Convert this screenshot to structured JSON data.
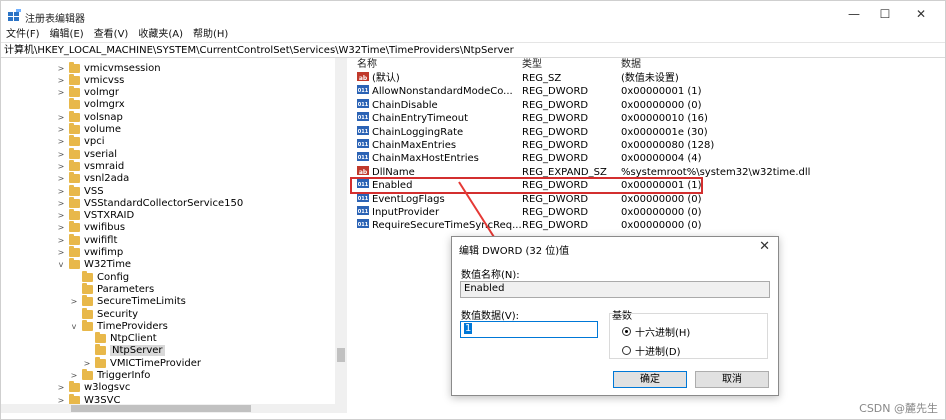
{
  "window": {
    "title": "注册表编辑器",
    "minimize": "—",
    "maximize": "☐",
    "close": "✕"
  },
  "menu": [
    "文件(F)",
    "编辑(E)",
    "查看(V)",
    "收藏夹(A)",
    "帮助(H)"
  ],
  "address": "计算机\\HKEY_LOCAL_MACHINE\\SYSTEM\\CurrentControlSet\\Services\\W32Time\\TimeProviders\\NtpServer",
  "tree": [
    {
      "label": "vmicvmsession",
      "depth": 0,
      "expander": ">"
    },
    {
      "label": "vmicvss",
      "depth": 0,
      "expander": ">"
    },
    {
      "label": "volmgr",
      "depth": 0,
      "expander": ">"
    },
    {
      "label": "volmgrx",
      "depth": 0,
      "expander": ""
    },
    {
      "label": "volsnap",
      "depth": 0,
      "expander": ">"
    },
    {
      "label": "volume",
      "depth": 0,
      "expander": ">"
    },
    {
      "label": "vpci",
      "depth": 0,
      "expander": ">"
    },
    {
      "label": "vserial",
      "depth": 0,
      "expander": ">"
    },
    {
      "label": "vsmraid",
      "depth": 0,
      "expander": ">"
    },
    {
      "label": "vsnl2ada",
      "depth": 0,
      "expander": ">"
    },
    {
      "label": "VSS",
      "depth": 0,
      "expander": ">"
    },
    {
      "label": "VSStandardCollectorService150",
      "depth": 0,
      "expander": ">"
    },
    {
      "label": "VSTXRAID",
      "depth": 0,
      "expander": ">"
    },
    {
      "label": "vwifibus",
      "depth": 0,
      "expander": ">"
    },
    {
      "label": "vwififlt",
      "depth": 0,
      "expander": ">"
    },
    {
      "label": "vwifimp",
      "depth": 0,
      "expander": ">"
    },
    {
      "label": "W32Time",
      "depth": 0,
      "expander": "v"
    },
    {
      "label": "Config",
      "depth": 1,
      "expander": ""
    },
    {
      "label": "Parameters",
      "depth": 1,
      "expander": ""
    },
    {
      "label": "SecureTimeLimits",
      "depth": 1,
      "expander": ">"
    },
    {
      "label": "Security",
      "depth": 1,
      "expander": ""
    },
    {
      "label": "TimeProviders",
      "depth": 1,
      "expander": "v"
    },
    {
      "label": "NtpClient",
      "depth": 2,
      "expander": ""
    },
    {
      "label": "NtpServer",
      "depth": 2,
      "expander": "",
      "selected": true
    },
    {
      "label": "VMICTimeProvider",
      "depth": 2,
      "expander": ">"
    },
    {
      "label": "TriggerInfo",
      "depth": 1,
      "expander": ">"
    },
    {
      "label": "w3logsvc",
      "depth": 0,
      "expander": ">"
    },
    {
      "label": "W3SVC",
      "depth": 0,
      "expander": ">"
    }
  ],
  "list": {
    "headers": {
      "name": "名称",
      "type": "类型",
      "data": "数据"
    },
    "rows": [
      {
        "icon": "ab",
        "name": "(默认)",
        "type": "REG_SZ",
        "data": "(数值未设置)"
      },
      {
        "icon": "011",
        "name": "AllowNonstandardModeCo...",
        "type": "REG_DWORD",
        "data": "0x00000001 (1)"
      },
      {
        "icon": "011",
        "name": "ChainDisable",
        "type": "REG_DWORD",
        "data": "0x00000000 (0)"
      },
      {
        "icon": "011",
        "name": "ChainEntryTimeout",
        "type": "REG_DWORD",
        "data": "0x00000010 (16)"
      },
      {
        "icon": "011",
        "name": "ChainLoggingRate",
        "type": "REG_DWORD",
        "data": "0x0000001e (30)"
      },
      {
        "icon": "011",
        "name": "ChainMaxEntries",
        "type": "REG_DWORD",
        "data": "0x00000080 (128)"
      },
      {
        "icon": "011",
        "name": "ChainMaxHostEntries",
        "type": "REG_DWORD",
        "data": "0x00000004 (4)"
      },
      {
        "icon": "ab",
        "name": "DllName",
        "type": "REG_EXPAND_SZ",
        "data": "%systemroot%\\system32\\w32time.dll"
      },
      {
        "icon": "011",
        "name": "Enabled",
        "type": "REG_DWORD",
        "data": "0x00000001 (1)"
      },
      {
        "icon": "011",
        "name": "EventLogFlags",
        "type": "REG_DWORD",
        "data": "0x00000000 (0)"
      },
      {
        "icon": "011",
        "name": "InputProvider",
        "type": "REG_DWORD",
        "data": "0x00000000 (0)"
      },
      {
        "icon": "011",
        "name": "RequireSecureTimeSyncReq...",
        "type": "REG_DWORD",
        "data": "0x00000000 (0)"
      }
    ]
  },
  "dialog": {
    "title": "编辑 DWORD (32 位)值",
    "close": "✕",
    "name_label": "数值名称(N):",
    "name_value": "Enabled",
    "data_label": "数值数据(V):",
    "data_value": "1",
    "base_label": "基数",
    "hex_label": "十六进制(H)",
    "dec_label": "十进制(D)",
    "ok": "确定",
    "cancel": "取消"
  },
  "colors": {
    "highlight": "#d32f2f",
    "arrow": "#e53935"
  },
  "watermark": "CSDN @麓先生"
}
